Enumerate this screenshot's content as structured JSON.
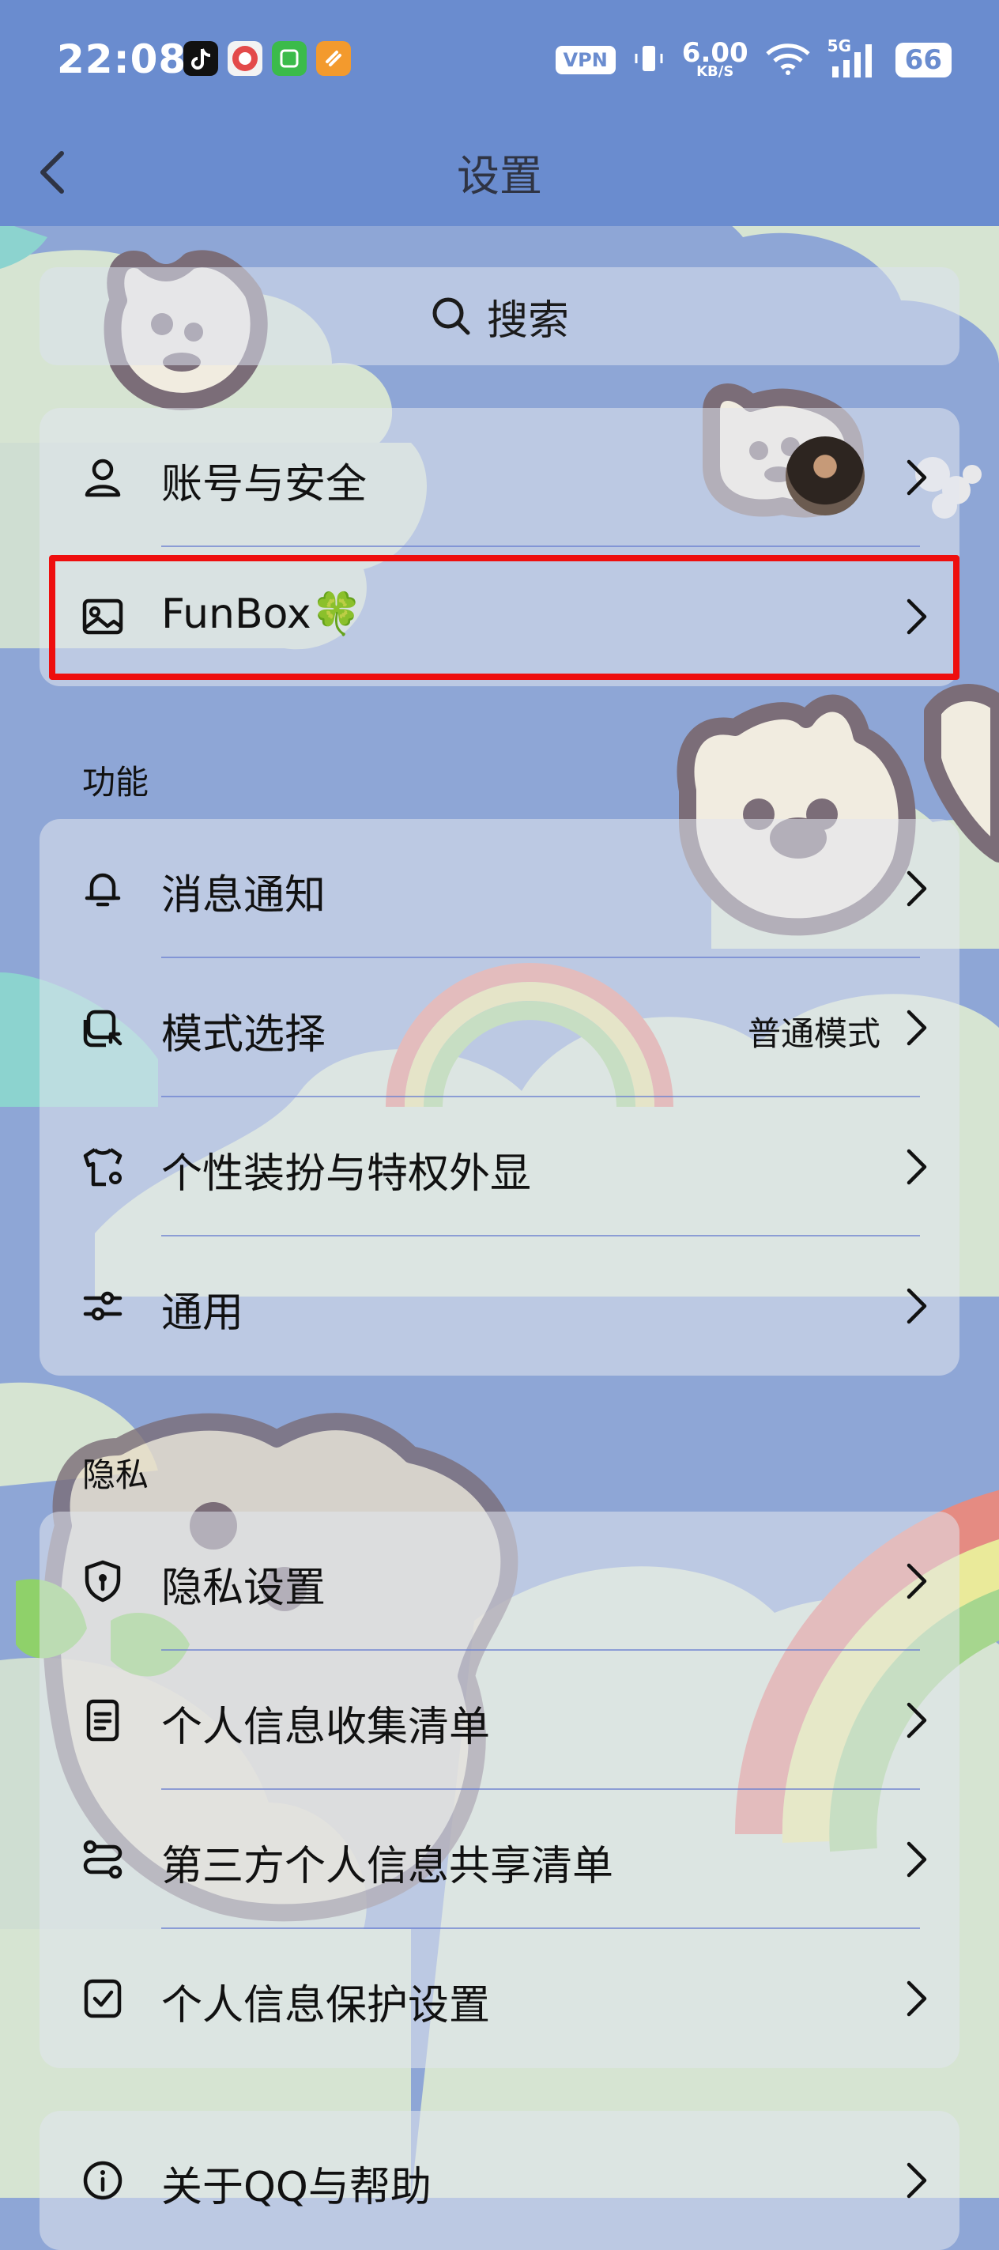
{
  "status_bar": {
    "time": "22:08",
    "vpn": "VPN",
    "speed_value": "6.00",
    "speed_unit": "KB/S",
    "network": "5G",
    "battery": "66"
  },
  "header": {
    "title": "设置"
  },
  "search": {
    "label": "搜索"
  },
  "account_group": [
    {
      "label": "账号与安全",
      "icon": "person-icon"
    },
    {
      "label": "FunBox🍀",
      "icon": "image-icon"
    }
  ],
  "features": {
    "section_title": "功能",
    "items": [
      {
        "label": "消息通知",
        "value": "",
        "icon": "bell-icon"
      },
      {
        "label": "模式选择",
        "value": "普通模式",
        "icon": "mode-icon"
      },
      {
        "label": "个性装扮与特权外显",
        "value": "",
        "icon": "tshirt-icon"
      },
      {
        "label": "通用",
        "value": "",
        "icon": "sliders-icon"
      }
    ]
  },
  "privacy": {
    "section_title": "隐私",
    "items": [
      {
        "label": "隐私设置",
        "icon": "shield-icon"
      },
      {
        "label": "个人信息收集清单",
        "icon": "document-icon"
      },
      {
        "label": "第三方个人信息共享清单",
        "icon": "share-icon"
      },
      {
        "label": "个人信息保护设置",
        "icon": "checkbox-icon"
      }
    ]
  },
  "about": {
    "label": "关于QQ与帮助",
    "icon": "info-icon"
  },
  "colors": {
    "header_bg": "#6a8ccf",
    "highlight": "#ee0e0e",
    "divider": "#6a7fd0"
  }
}
